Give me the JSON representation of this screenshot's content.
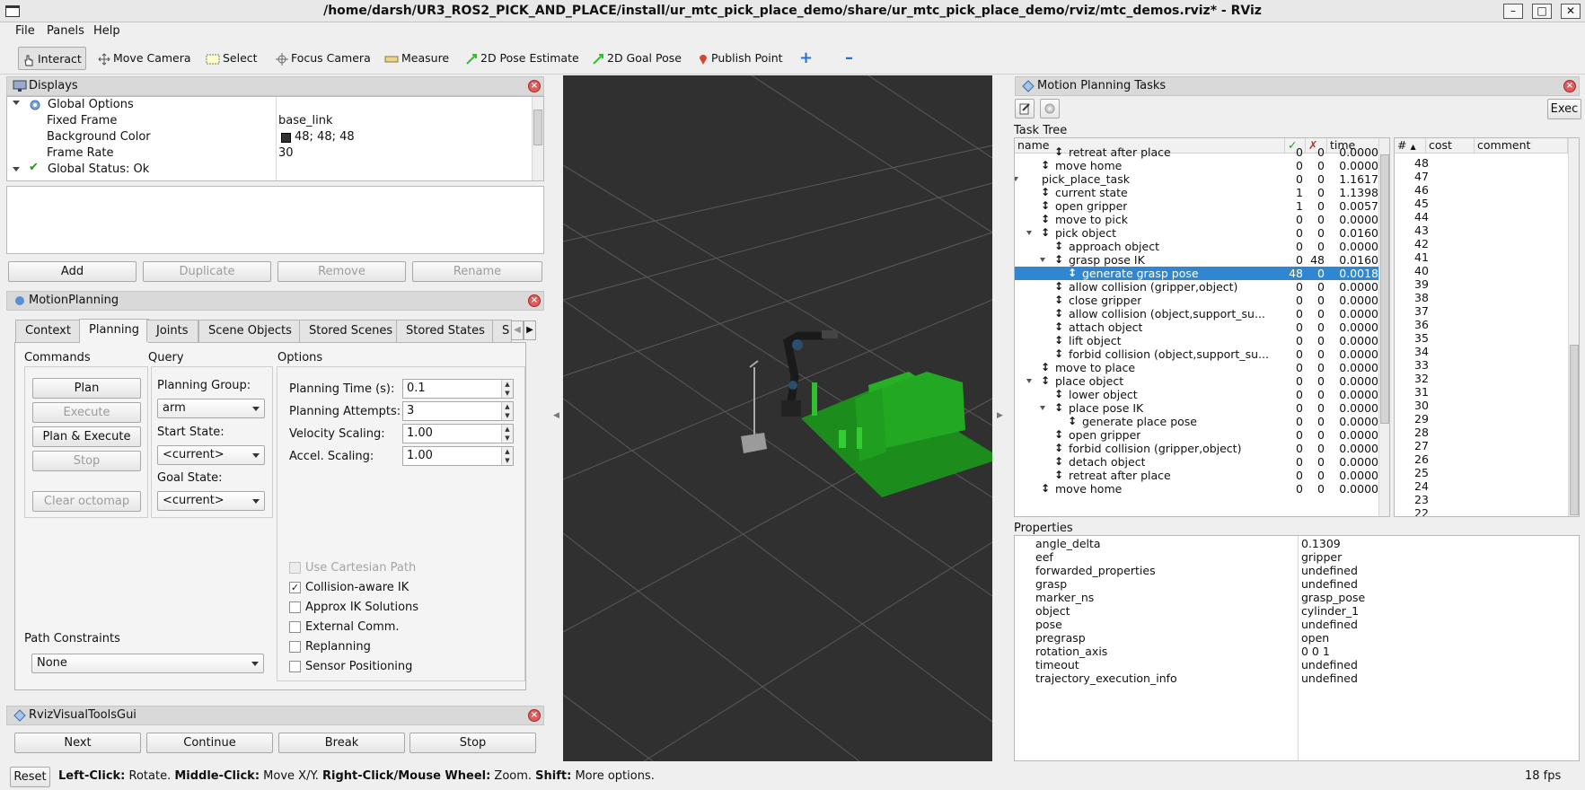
{
  "window": {
    "title": "/home/darsh/UR3_ROS2_PICK_AND_PLACE/install/ur_mtc_pick_place_demo/share/ur_mtc_pick_place_demo/rviz/mtc_demos.rviz* - RViz"
  },
  "menu": {
    "file": "File",
    "panels": "Panels",
    "help": "Help"
  },
  "toolbar": {
    "interact": "Interact",
    "move_camera": "Move Camera",
    "select": "Select",
    "focus_camera": "Focus Camera",
    "measure": "Measure",
    "pose_estimate": "2D Pose Estimate",
    "goal_pose": "2D Goal Pose",
    "publish_point": "Publish Point"
  },
  "displays": {
    "title": "Displays",
    "global_options": "Global Options",
    "fixed_frame_label": "Fixed Frame",
    "fixed_frame_value": "base_link",
    "bg_color_label": "Background Color",
    "bg_color_value": "48; 48; 48",
    "bg_color": "#303030",
    "frame_rate_label": "Frame Rate",
    "frame_rate_value": "30",
    "global_status": "Global Status: Ok",
    "add": "Add",
    "duplicate": "Duplicate",
    "remove": "Remove",
    "rename": "Rename"
  },
  "motion_planning": {
    "title": "MotionPlanning",
    "tabs": [
      "Context",
      "Planning",
      "Joints",
      "Scene Objects",
      "Stored Scenes",
      "Stored States",
      "S"
    ],
    "commands_label": "Commands",
    "query_label": "Query",
    "options_label": "Options",
    "plan": "Plan",
    "execute": "Execute",
    "plan_execute": "Plan & Execute",
    "stop": "Stop",
    "clear_octomap": "Clear octomap",
    "planning_group_label": "Planning Group:",
    "planning_group": "arm",
    "start_state_label": "Start State:",
    "start_state": "<current>",
    "goal_state_label": "Goal State:",
    "goal_state": "<current>",
    "planning_time_label": "Planning Time (s):",
    "planning_time": "0.1",
    "planning_attempts_label": "Planning Attempts:",
    "planning_attempts": "3",
    "velocity_label": "Velocity Scaling:",
    "velocity": "1.00",
    "accel_label": "Accel. Scaling:",
    "accel": "1.00",
    "use_cartesian": "Use Cartesian Path",
    "collision_ik": "Collision-aware IK",
    "approx_ik": "Approx IK Solutions",
    "external_comm": "External Comm.",
    "replanning": "Replanning",
    "sensor_positioning": "Sensor Positioning",
    "path_constraints_label": "Path Constraints",
    "path_constraints": "None"
  },
  "visual_tools": {
    "title": "RvizVisualToolsGui",
    "next": "Next",
    "continue": "Continue",
    "break": "Break",
    "stop": "Stop"
  },
  "mpt": {
    "title": "Motion Planning Tasks",
    "exec": "Exec",
    "task_tree_label": "Task Tree",
    "col_name": "name",
    "col_ok": "✓",
    "col_fail": "✗",
    "col_time": "time",
    "col_hash": "#",
    "col_cost": "cost",
    "col_comment": "comment",
    "rows": [
      {
        "name": "retreat after place",
        "ok": "0",
        "fail": "0",
        "time": "0.0000"
      },
      {
        "name": "move home",
        "ok": "0",
        "fail": "0",
        "time": "0.0000"
      },
      {
        "name": "pick_place_task",
        "ok": "0",
        "fail": "0",
        "time": "1.1617"
      },
      {
        "name": "current state",
        "ok": "1",
        "fail": "0",
        "time": "1.1398"
      },
      {
        "name": "open gripper",
        "ok": "1",
        "fail": "0",
        "time": "0.0057"
      },
      {
        "name": "move to pick",
        "ok": "0",
        "fail": "0",
        "time": "0.0000"
      },
      {
        "name": "pick object",
        "ok": "0",
        "fail": "0",
        "time": "0.0160"
      },
      {
        "name": "approach object",
        "ok": "0",
        "fail": "0",
        "time": "0.0000"
      },
      {
        "name": "grasp pose IK",
        "ok": "0",
        "fail": "48",
        "time": "0.0160"
      },
      {
        "name": "generate grasp pose",
        "ok": "48",
        "fail": "0",
        "time": "0.0018"
      },
      {
        "name": "allow collision (gripper,object)",
        "ok": "0",
        "fail": "0",
        "time": "0.0000"
      },
      {
        "name": "close gripper",
        "ok": "0",
        "fail": "0",
        "time": "0.0000"
      },
      {
        "name": "allow collision (object,support_su...",
        "ok": "0",
        "fail": "0",
        "time": "0.0000"
      },
      {
        "name": "attach object",
        "ok": "0",
        "fail": "0",
        "time": "0.0000"
      },
      {
        "name": "lift object",
        "ok": "0",
        "fail": "0",
        "time": "0.0000"
      },
      {
        "name": "forbid collision (object,support_su...",
        "ok": "0",
        "fail": "0",
        "time": "0.0000"
      },
      {
        "name": "move to place",
        "ok": "0",
        "fail": "0",
        "time": "0.0000"
      },
      {
        "name": "place object",
        "ok": "0",
        "fail": "0",
        "time": "0.0000"
      },
      {
        "name": "lower object",
        "ok": "0",
        "fail": "0",
        "time": "0.0000"
      },
      {
        "name": "place pose IK",
        "ok": "0",
        "fail": "0",
        "time": "0.0000"
      },
      {
        "name": "generate place pose",
        "ok": "0",
        "fail": "0",
        "time": "0.0000"
      },
      {
        "name": "open gripper",
        "ok": "0",
        "fail": "0",
        "time": "0.0000"
      },
      {
        "name": "forbid collision (gripper,object)",
        "ok": "0",
        "fail": "0",
        "time": "0.0000"
      },
      {
        "name": "detach object",
        "ok": "0",
        "fail": "0",
        "time": "0.0000"
      },
      {
        "name": "retreat after place",
        "ok": "0",
        "fail": "0",
        "time": "0.0000"
      },
      {
        "name": "move home",
        "ok": "0",
        "fail": "0",
        "time": "0.0000"
      }
    ],
    "solutions": [
      "48",
      "47",
      "46",
      "45",
      "44",
      "43",
      "42",
      "41",
      "40",
      "39",
      "38",
      "37",
      "36",
      "35",
      "34",
      "33",
      "32",
      "31",
      "30",
      "29",
      "28",
      "27",
      "26",
      "25",
      "24",
      "23",
      "22"
    ],
    "properties_label": "Properties",
    "properties": [
      {
        "k": "angle_delta",
        "v": "0.1309"
      },
      {
        "k": "eef",
        "v": "gripper"
      },
      {
        "k": "forwarded_properties",
        "v": "undefined"
      },
      {
        "k": "grasp",
        "v": "undefined"
      },
      {
        "k": "marker_ns",
        "v": "grasp_pose"
      },
      {
        "k": "object",
        "v": "cylinder_1"
      },
      {
        "k": "pose",
        "v": "undefined"
      },
      {
        "k": "pregrasp",
        "v": "open"
      },
      {
        "k": "rotation_axis",
        "v": "0 0 1"
      },
      {
        "k": "timeout",
        "v": "undefined"
      },
      {
        "k": "trajectory_execution_info",
        "v": "undefined"
      }
    ]
  },
  "status": {
    "reset": "Reset",
    "h1": "Left-Click:",
    "t1": " Rotate. ",
    "h2": "Middle-Click:",
    "t2": " Move X/Y. ",
    "h3": "Right-Click/Mouse Wheel:",
    "t3": " Zoom. ",
    "h4": "Shift:",
    "t4": " More options.",
    "fps": "18 fps"
  },
  "colors": {
    "selection": "#3186d1",
    "scene_green": "#1f9e1f",
    "viewport_bg": "#303030"
  }
}
